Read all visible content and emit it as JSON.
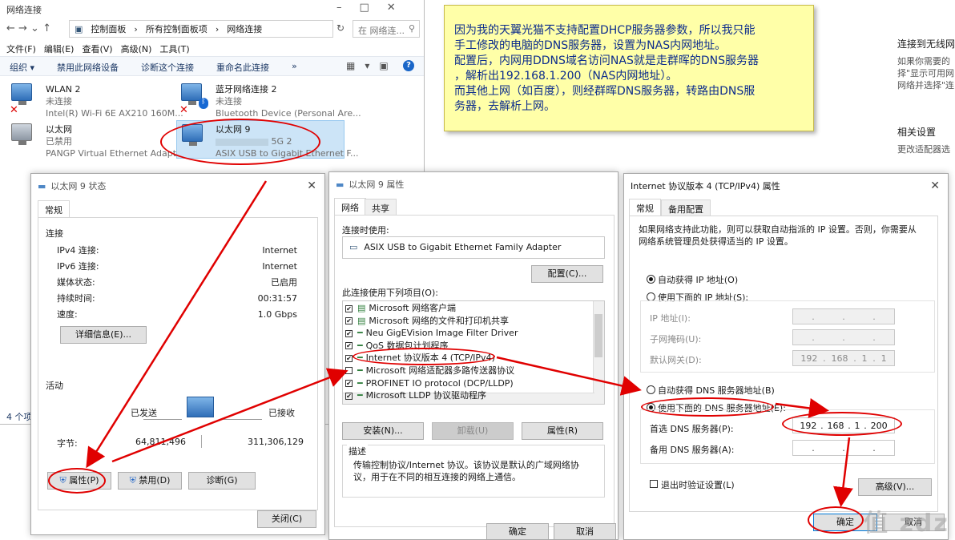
{
  "explorer": {
    "title": "网络连接",
    "breadcrumb": [
      "控制面板",
      "所有控制面板项",
      "网络连接"
    ],
    "search_placeholder": "在 网络连...",
    "menu": [
      "文件(F)",
      "编辑(E)",
      "查看(V)",
      "高级(N)",
      "工具(T)"
    ],
    "toolbar": [
      "组织 ▾",
      "禁用此网络设备",
      "诊断这个连接",
      "重命名此连接",
      "»"
    ],
    "items": [
      {
        "name": "WLAN 2",
        "status": "未连接",
        "device": "Intel(R) Wi-Fi 6E AX210 160M..."
      },
      {
        "name": "蓝牙网络连接 2",
        "status": "未连接",
        "device": "Bluetooth Device (Personal Are..."
      },
      {
        "name": "以太网",
        "status": "已禁用",
        "device": "PANGP Virtual Ethernet Adapt..."
      },
      {
        "name": "以太网 9",
        "status": "5G 2",
        "device": "ASIX USB to Gigabit Ethernet F..."
      }
    ],
    "count": "4 个项"
  },
  "note": {
    "lines": [
      "因为我的天翼光猫不支持配置DHCP服务器参数，所以我只能",
      "手工修改的电脑的DNS服务器，设置为NAS内网地址。",
      "配置后，内网用DDNS域名访问NAS就是走群晖的DNS服务器",
      "，解析出192.168.1.200（NAS内网地址）。",
      "而其他上网（如百度），则经群晖DNS服务器，转路由DNS服",
      "务器，去解析上网。"
    ]
  },
  "settings": {
    "t1": "连接到无线网",
    "d1": "如果你需要的",
    "d2": "择\"显示可用网",
    "d3": "网络并选择\"连",
    "t2": "相关设置",
    "d4": "更改适配器选"
  },
  "status_dlg": {
    "title": "以太网 9 状态",
    "tab": "常规",
    "section_conn": "连接",
    "rows": [
      [
        "IPv4 连接:",
        "Internet"
      ],
      [
        "IPv6 连接:",
        "Internet"
      ],
      [
        "媒体状态:",
        "已启用"
      ],
      [
        "持续时间:",
        "00:31:57"
      ],
      [
        "速度:",
        "1.0 Gbps"
      ]
    ],
    "details": "详细信息(E)...",
    "section_act": "活动",
    "sent": "已发送",
    "recv": "已接收",
    "bytes_label": "字节:",
    "bytes_sent": "64,811,496",
    "bytes_recv": "311,306,129",
    "btn_prop": "属性(P)",
    "btn_disable": "禁用(D)",
    "btn_diag": "诊断(G)",
    "btn_close": "关闭(C)"
  },
  "prop_dlg": {
    "title": "以太网 9 属性",
    "tabs": [
      "网络",
      "共享"
    ],
    "connect_using": "连接时使用:",
    "adapter": "ASIX USB to Gigabit Ethernet Family Adapter",
    "config": "配置(C)...",
    "items_label": "此连接使用下列项目(O):",
    "items": [
      "Microsoft 网络客户端",
      "Microsoft 网络的文件和打印机共享",
      "Neu GigEVision Image Filter Driver",
      "QoS 数据包计划程序",
      "Internet 协议版本 4 (TCP/IPv4)",
      "Microsoft 网络适配器多路传送器协议",
      "PROFINET IO protocol (DCP/LLDP)",
      "Microsoft LLDP 协议驱动程序"
    ],
    "install": "安装(N)...",
    "uninstall": "卸载(U)",
    "props": "属性(R)",
    "desc_label": "描述",
    "desc": "传输控制协议/Internet 协议。该协议是默认的广域网络协议，用于在不同的相互连接的网络上通信。",
    "ok": "确定",
    "cancel": "取消"
  },
  "ipv4_dlg": {
    "title": "Internet 协议版本 4 (TCP/IPv4) 属性",
    "tabs": [
      "常规",
      "备用配置"
    ],
    "intro": "如果网络支持此功能，则可以获取自动指派的 IP 设置。否则，你需要从网络系统管理员处获得适当的 IP 设置。",
    "auto_ip": "自动获得 IP 地址(O)",
    "manual_ip": "使用下面的 IP 地址(S):",
    "ip_label": "IP 地址(I):",
    "mask_label": "子网掩码(U):",
    "gw_label": "默认网关(D):",
    "gw": [
      "192",
      "168",
      "1",
      "1"
    ],
    "auto_dns": "自动获得 DNS 服务器地址(B)",
    "manual_dns": "使用下面的 DNS 服务器地址(E):",
    "pref_label": "首选 DNS 服务器(P):",
    "pref": [
      "192",
      "168",
      "1",
      "200"
    ],
    "alt_label": "备用 DNS 服务器(A):",
    "validate": "退出时验证设置(L)",
    "advanced": "高级(V)...",
    "ok": "确定",
    "cancel": "取消"
  },
  "watermark": "值 zdz"
}
